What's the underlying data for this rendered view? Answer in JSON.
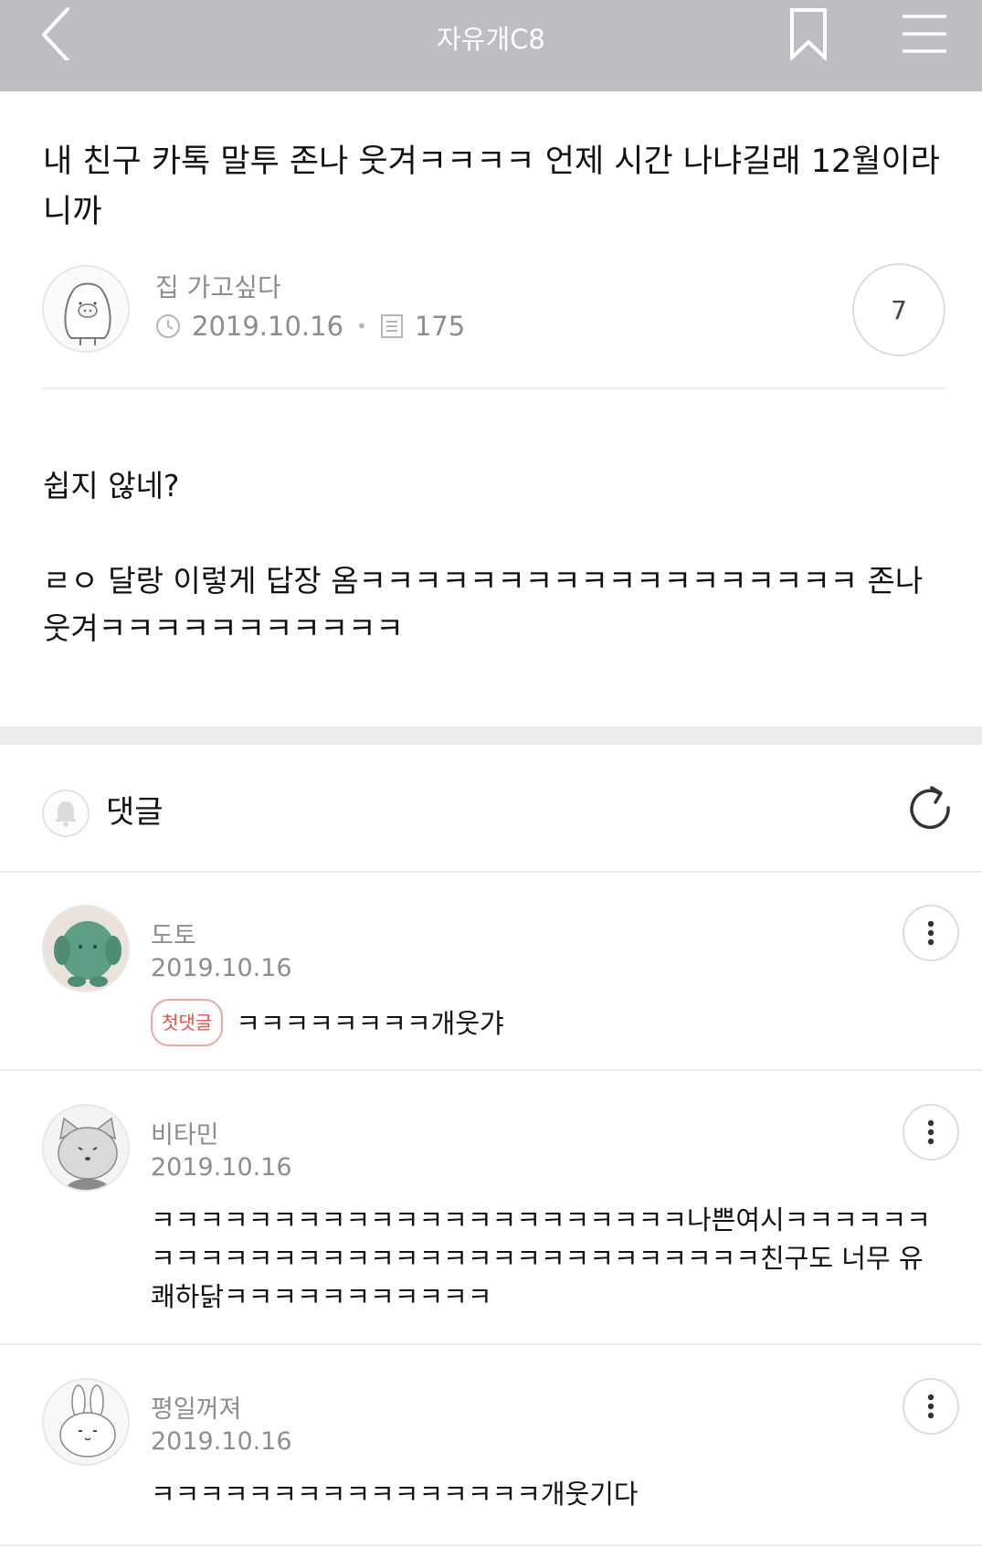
{
  "header": {
    "board_title": "자유개C8",
    "back_icon": "chevron-left-icon",
    "bookmark_icon": "bookmark-icon",
    "menu_icon": "hamburger-menu-icon"
  },
  "post": {
    "title": "내 친구 카톡 말투 존나 웃겨ㅋㅋㅋㅋ 언제 시간 나냐길래 12월이라니까",
    "author": "집 가고싶다",
    "date": "2019.10.16",
    "views": "175",
    "comment_count": "7",
    "paragraphs": [
      "쉽지 않네?",
      "ㄹㅇ 달랑 이렇게 답장 옴ㅋㅋㅋㅋㅋㅋㅋㅋㅋㅋㅋㅋㅋㅋㅋㅋㅋㅋ 존나 웃겨ㅋㅋㅋㅋㅋㅋㅋㅋㅋㅋㅋ"
    ]
  },
  "comments_section": {
    "label": "댓글"
  },
  "comments": [
    {
      "name": "도토",
      "date": "2019.10.16",
      "badge": "첫댓글",
      "text": "ㅋㅋㅋㅋㅋㅋㅋㅋ개웃갸"
    },
    {
      "name": "비타민",
      "date": "2019.10.16",
      "text": "ㅋㅋㅋㅋㅋㅋㅋㅋㅋㅋㅋㅋㅋㅋㅋㅋㅋㅋㅋㅋㅋㅋ나쁜여시ㅋㅋㅋㅋㅋㅋㅋㅋㅋㅋㅋㅋㅋㅋㅋㅋㅋㅋㅋㅋㅋㅋㅋㅋㅋㅋㅋㅋㅋㅋㅋ친구도 너무 유쾌하닭ㅋㅋㅋㅋㅋㅋㅋㅋㅋㅋㅋ"
    },
    {
      "name": "평일꺼져",
      "date": "2019.10.16",
      "text": "ㅋㅋㅋㅋㅋㅋㅋㅋㅋㅋㅋㅋㅋㅋㅋㅋ개웃기다"
    }
  ]
}
